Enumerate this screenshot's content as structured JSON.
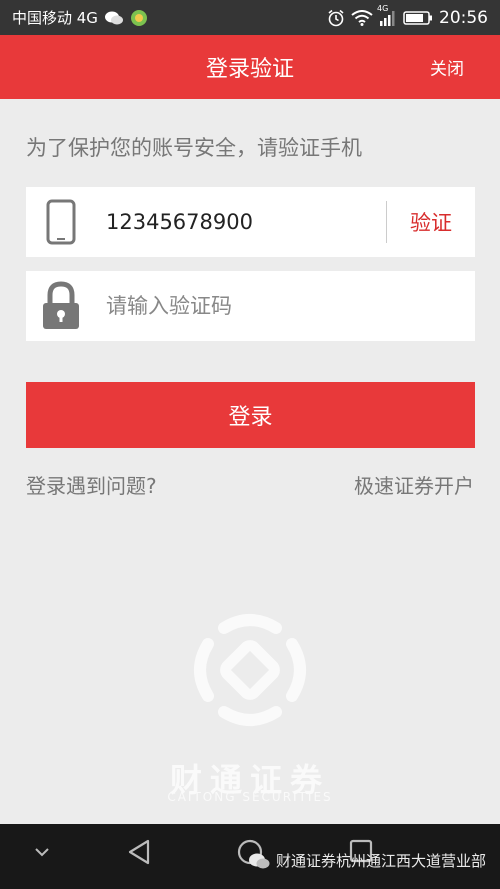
{
  "status_bar": {
    "carrier": "中国移动 4G",
    "network_badge": "4G",
    "time": "20:56",
    "icons": [
      "wechat-icon",
      "app-notification-icon",
      "alarm-icon",
      "wifi-icon",
      "signal-icon",
      "battery-icon"
    ]
  },
  "header": {
    "title": "登录验证",
    "close_label": "关闭"
  },
  "hint": "为了保护您的账号安全，请验证手机",
  "phone_field": {
    "value": "12345678900",
    "verify_label": "验证"
  },
  "code_field": {
    "placeholder": "请输入验证码"
  },
  "login_label": "登录",
  "links": {
    "problem": "登录遇到问题?",
    "open_account": "极速证券开户"
  },
  "logo": {
    "cn": "财通证券",
    "en": "CAITONG SECURITIES"
  },
  "watermark": "财通证券杭州通江西大道营业部",
  "colors": {
    "accent": "#e8393a",
    "background": "#ececec",
    "status_bar": "#353535",
    "nav_bar": "#181818"
  }
}
